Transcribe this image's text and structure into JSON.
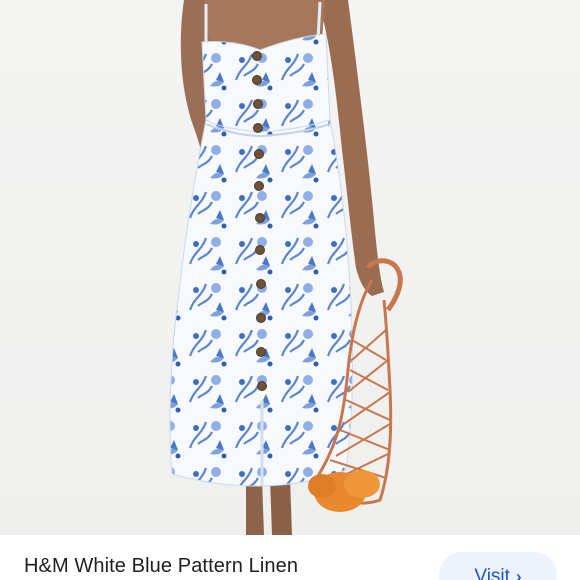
{
  "product": {
    "image_name": "dress-photo",
    "title": "H&M White Blue Pattern Linen"
  },
  "actions": {
    "visit_label": "Visit",
    "visit_icon": "chevron-right-icon"
  },
  "colors": {
    "background": "#f2f2f1",
    "accent": "#1a56c9",
    "button_bg": "#eef2fb"
  }
}
